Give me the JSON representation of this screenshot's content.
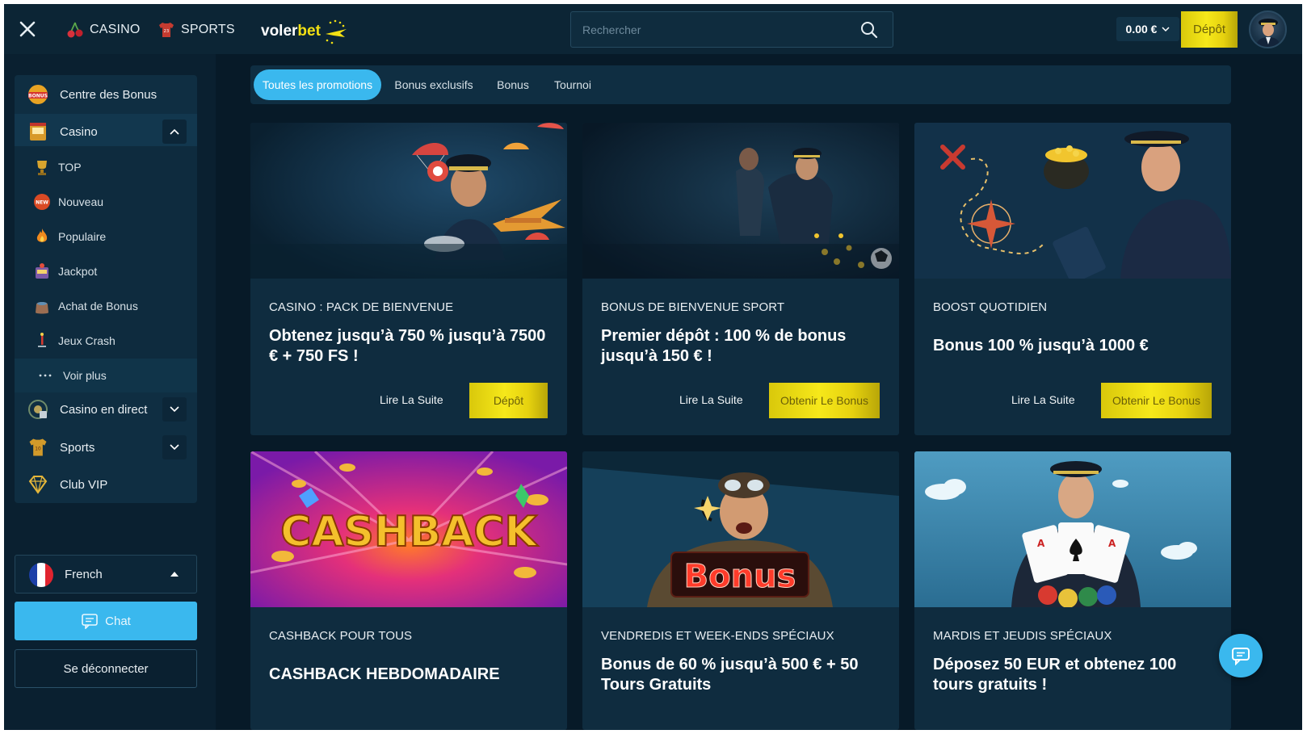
{
  "header": {
    "nav": [
      {
        "label": "CASINO",
        "icon": "cherry-icon"
      },
      {
        "label": "SPORTS",
        "icon": "jersey-icon"
      }
    ],
    "logo": {
      "part1": "voler",
      "part2": "bet"
    },
    "search": {
      "placeholder": "Rechercher"
    },
    "balance": "0.00 €",
    "deposit_label": "Dépôt"
  },
  "sidebar": {
    "items": [
      {
        "label": "Centre des Bonus",
        "icon": "bonus-icon"
      },
      {
        "label": "Casino",
        "icon": "slot-machine-icon",
        "expanded": true
      },
      {
        "label": "Casino en direct",
        "icon": "live-casino-icon"
      },
      {
        "label": "Sports",
        "icon": "jersey-icon"
      },
      {
        "label": "Club VIP",
        "icon": "diamond-icon"
      }
    ],
    "casino_sub": [
      {
        "label": "TOP",
        "icon": "trophy-icon"
      },
      {
        "label": "Nouveau",
        "icon": "new-badge-icon"
      },
      {
        "label": "Populaire",
        "icon": "fire-icon"
      },
      {
        "label": "Jackpot",
        "icon": "jackpot-icon"
      },
      {
        "label": "Achat de Bonus",
        "icon": "bag-icon"
      },
      {
        "label": "Jeux Crash",
        "icon": "rocket-icon"
      },
      {
        "label": "Voir plus",
        "icon": "dots-icon"
      }
    ],
    "language": "French",
    "chat_label": "Chat",
    "logout_label": "Se déconnecter"
  },
  "filters": {
    "tabs": [
      "Toutes les promotions",
      "Bonus exclusifs",
      "Bonus",
      "Tournoi"
    ],
    "active": 0
  },
  "promos": [
    {
      "category": "CASINO : PACK DE BIENVENUE",
      "headline": "Obtenez jusqu’à 750 % jusqu’à 7500 € + 750 FS !",
      "read_more": "Lire La Suite",
      "cta": "Dépôt"
    },
    {
      "category": "BONUS DE BIENVENUE SPORT",
      "headline": "Premier dépôt : 100 % de bonus jusqu’à 150 € !",
      "read_more": "Lire La Suite",
      "cta": "Obtenir Le Bonus"
    },
    {
      "category": "BOOST QUOTIDIEN",
      "headline": "Bonus 100 % jusqu’à 1000 €",
      "read_more": "Lire La Suite",
      "cta": "Obtenir Le Bonus"
    },
    {
      "category": "CASHBACK POUR TOUS",
      "headline": "CASHBACK HEBDOMADAIRE",
      "banner_text": "CASHBACK"
    },
    {
      "category": "VENDREDIS ET WEEK-ENDS SPÉCIAUX",
      "headline": "Bonus de 60 % jusqu’à 500 € + 50 Tours Gratuits",
      "banner_text": "Bonus"
    },
    {
      "category": "MARDIS ET JEUDIS SPÉCIAUX",
      "headline": "Déposez 50 EUR et obtenez 100 tours gratuits !"
    }
  ],
  "colors": {
    "accent_blue": "#3ab8ee",
    "gold": "#f6e81a",
    "background": "#071a28",
    "panel": "#0f2e42"
  }
}
